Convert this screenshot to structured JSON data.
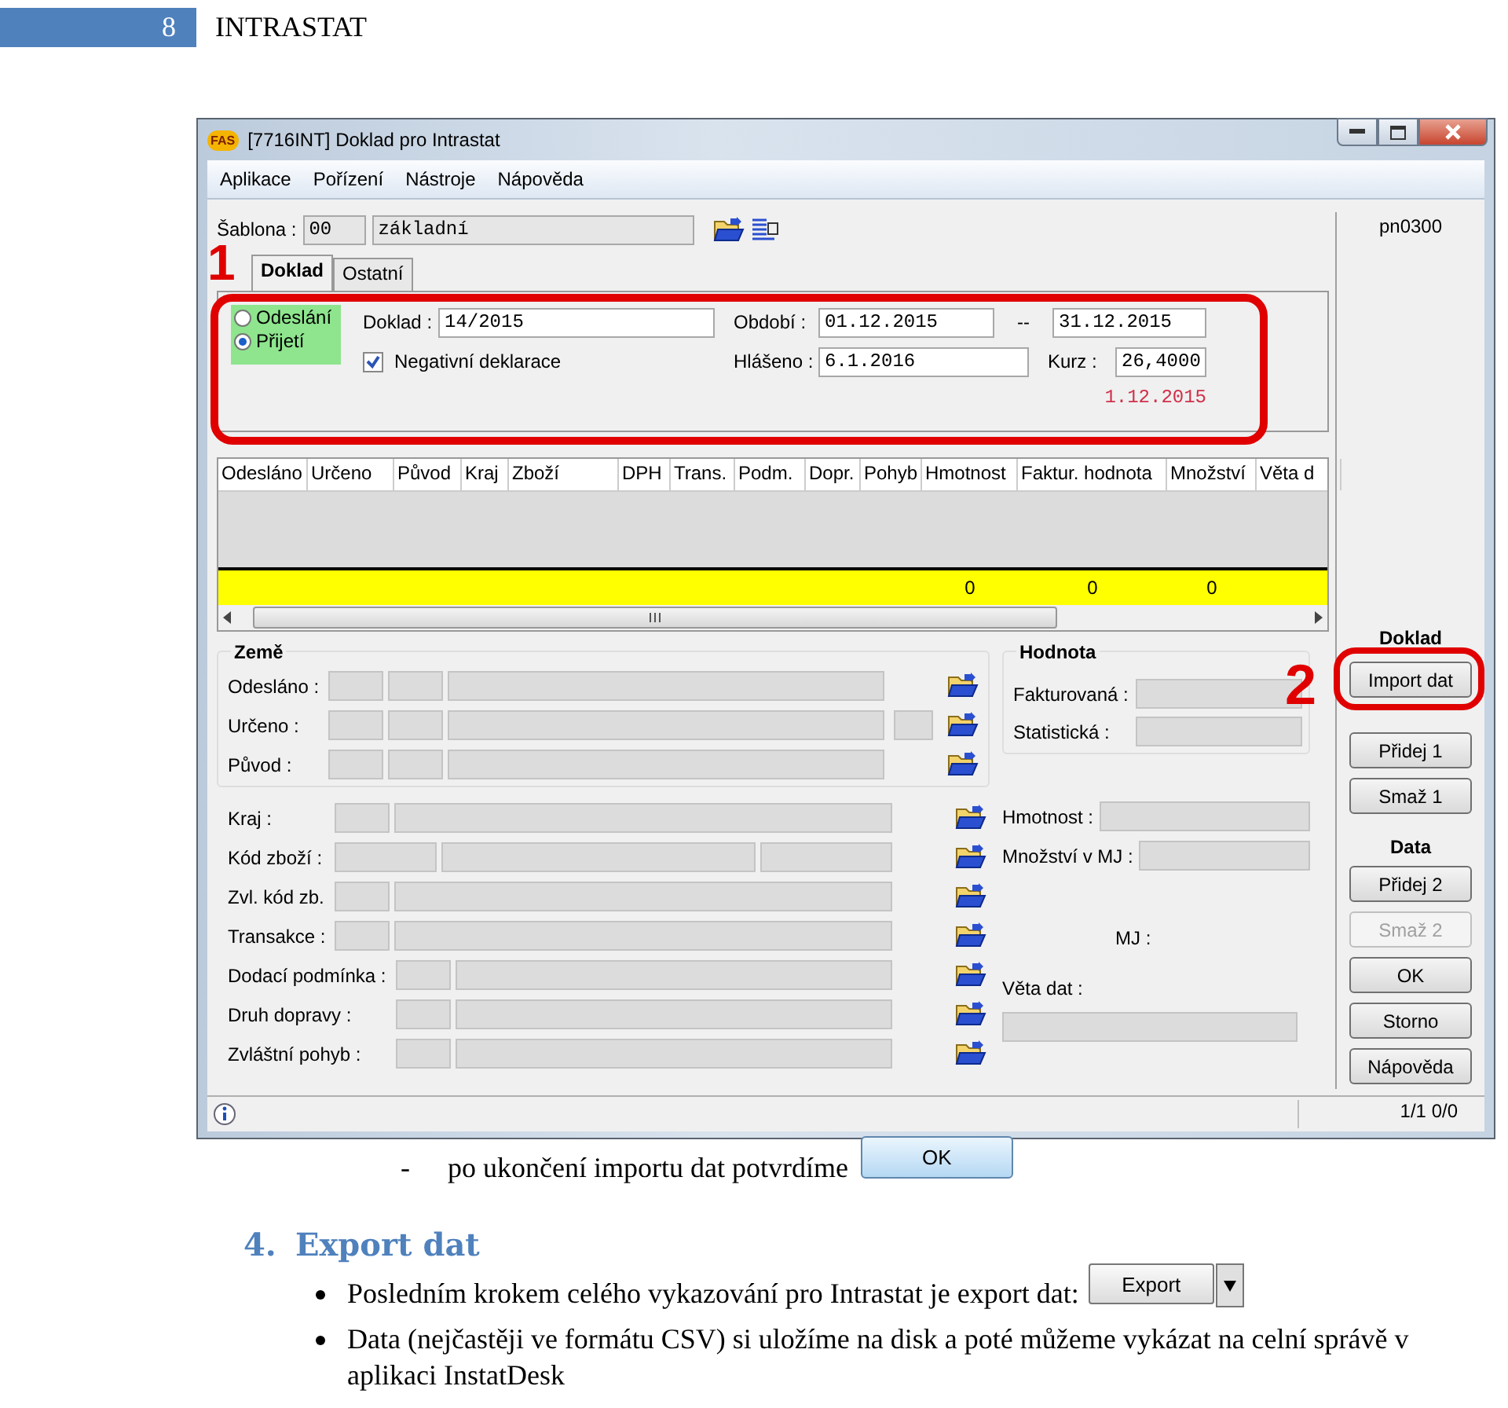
{
  "page_header": {
    "number": "8",
    "title": "INTRASTAT"
  },
  "window": {
    "logo": "FAS",
    "title": "[7716INT] Doklad pro Intrastat"
  },
  "menu": [
    "Aplikace",
    "Pořízení",
    "Nástroje",
    "Nápověda"
  ],
  "template": {
    "label": "Šablona :",
    "code": "00",
    "name": "základní"
  },
  "form_code": "pn0300",
  "tabs": [
    {
      "label": "Doklad",
      "selected": true
    },
    {
      "label": "Ostatní",
      "selected": false
    }
  ],
  "tab_panel": {
    "highlighted": true,
    "callout": "1"
  },
  "direction": [
    {
      "label": "Odeslání",
      "selected": false
    },
    {
      "label": "Přijetí",
      "selected": true
    }
  ],
  "document_no": {
    "label": "Doklad :",
    "value": "14/2015"
  },
  "negative": {
    "label": "Negativní deklarace",
    "checked": true
  },
  "period": {
    "label": "Období :",
    "from": "01.12.2015",
    "separator": "--",
    "to": "31.12.2015"
  },
  "reported": {
    "label": "Hlášeno :",
    "value": "6.1.2016"
  },
  "rate": {
    "label": "Kurz :",
    "value": "26,4000",
    "date": "1.12.2015"
  },
  "grid": {
    "columns": [
      {
        "label": "Odesláno"
      },
      {
        "label": "Určeno"
      },
      {
        "label": "Původ"
      },
      {
        "label": "Kraj"
      },
      {
        "label": "Zboží"
      },
      {
        "label": "DPH"
      },
      {
        "label": "Trans."
      },
      {
        "label": "Podm."
      },
      {
        "label": "Dopr."
      },
      {
        "label": "Pohyb"
      },
      {
        "label": "Hmotnost",
        "total": "0"
      },
      {
        "label": "Faktur. hodnota",
        "total": "0"
      },
      {
        "label": "Množství",
        "total": "0"
      },
      {
        "label": "Věta d"
      }
    ]
  },
  "country_group": {
    "title": "Země",
    "rows": [
      {
        "label": "Odesláno :",
        "fields": [
          {
            "kind": "code"
          },
          {
            "kind": "code"
          },
          {
            "kind": "name"
          }
        ]
      },
      {
        "label": "Určeno :",
        "fields": [
          {
            "kind": "code"
          },
          {
            "kind": "code"
          },
          {
            "kind": "name"
          },
          {
            "kind": "extra"
          }
        ]
      },
      {
        "label": "Původ :",
        "fields": [
          {
            "kind": "code"
          },
          {
            "kind": "code"
          },
          {
            "kind": "name"
          }
        ]
      }
    ]
  },
  "detail_rows": [
    {
      "label": "Kraj :",
      "fields": [
        {
          "kind": "code"
        },
        {
          "kind": "name"
        }
      ]
    },
    {
      "label": "Kód zboží :",
      "fields": [
        {
          "kind": "long"
        },
        {
          "kind": "name"
        },
        {
          "kind": "tail"
        }
      ]
    },
    {
      "label": "Zvl. kód zb.",
      "fields": [
        {
          "kind": "code"
        },
        {
          "kind": "name"
        }
      ]
    },
    {
      "label": "Transakce :",
      "fields": [
        {
          "kind": "code"
        },
        {
          "kind": "name"
        }
      ]
    }
  ],
  "transport_rows": [
    {
      "label": "Dodací podmínka :",
      "fields": [
        {
          "kind": "code"
        },
        {
          "kind": "name"
        }
      ]
    },
    {
      "label": "Druh dopravy :",
      "fields": [
        {
          "kind": "code"
        },
        {
          "kind": "name"
        }
      ]
    },
    {
      "label": "Zvláštní pohyb :",
      "fields": [
        {
          "kind": "code"
        },
        {
          "kind": "name"
        }
      ]
    }
  ],
  "value_group": {
    "title": "Hodnota",
    "rows": [
      {
        "label": "Fakturovaná :"
      },
      {
        "label": "Statistická :"
      }
    ]
  },
  "measure_rows": [
    {
      "label": "Hmotnost :"
    },
    {
      "label": "Množství v MJ :"
    }
  ],
  "unit_label": "MJ :",
  "record_label": "Věta dat :",
  "side_sections": [
    {
      "title": "Doklad",
      "buttons": [
        {
          "label": "Import dat",
          "disabled": false,
          "highlighted": true,
          "callout": "2"
        },
        {
          "label": "Přidej 1",
          "disabled": false,
          "highlighted": false
        },
        {
          "label": "Smaž 1",
          "disabled": false,
          "highlighted": false
        }
      ]
    },
    {
      "title": "Data",
      "buttons": [
        {
          "label": "Přidej 2",
          "disabled": false,
          "highlighted": false
        },
        {
          "label": "Smaž 2",
          "disabled": true,
          "highlighted": false
        },
        {
          "label": "OK",
          "disabled": false,
          "highlighted": false
        },
        {
          "label": "Storno",
          "disabled": false,
          "highlighted": false
        },
        {
          "label": "Nápověda",
          "disabled": false,
          "highlighted": false
        }
      ]
    }
  ],
  "status_bar": {
    "position": "1/1 0/0"
  },
  "document": {
    "step_note": {
      "marker": "-",
      "text": "po ukončení importu dat potvrdíme",
      "button": "OK"
    },
    "heading": {
      "number": "4.",
      "text": "Export dat"
    },
    "bullets": [
      {
        "text": "Posledním krokem celého vykazování pro Intrastat je export dat:",
        "button": "Export"
      },
      {
        "text": "Data (nejčastěji ve formátu CSV) si uložíme na disk a poté můžeme vykázat na celní správě v aplikaci InstatDesk"
      }
    ]
  }
}
